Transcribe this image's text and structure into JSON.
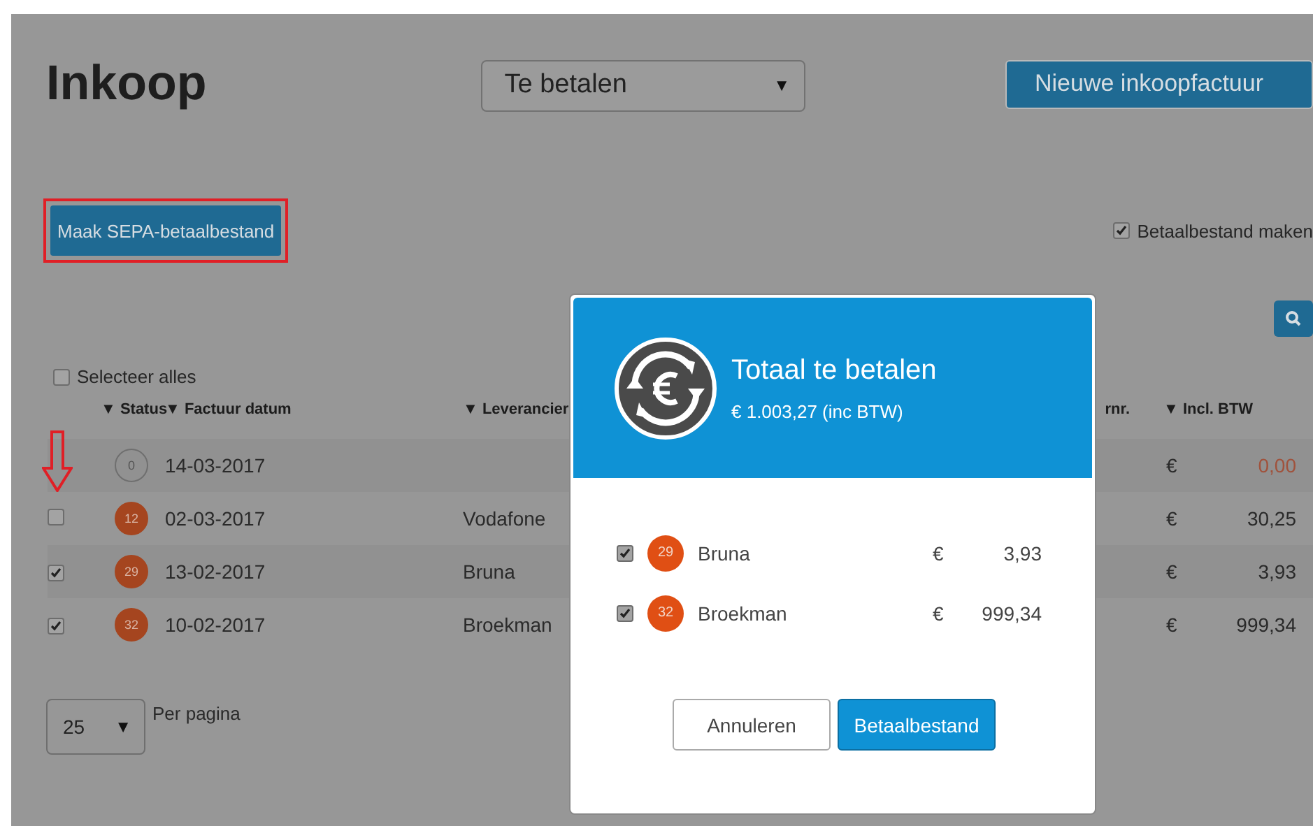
{
  "page": {
    "title": "Inkoop",
    "filter": {
      "value": "Te betalen",
      "arrow": "▼"
    },
    "new_button": "Nieuwe inkoopfactuur"
  },
  "sepa_button": {
    "label": "Maak SEPA-betaalbestand",
    "highlighted": true
  },
  "make_file": {
    "label": "Betaalbestand maken",
    "checked": true
  },
  "select_all": {
    "label": "Selecteer alles",
    "checked": false
  },
  "table": {
    "columns": [
      {
        "label": "▼ Status"
      },
      {
        "label": "▼ Factuur datum"
      },
      {
        "label": "▼ Leverancier"
      },
      {
        "label": "rnr."
      },
      {
        "label": "▼ Incl. BTW"
      }
    ],
    "rows": [
      {
        "kind": "plain",
        "status": "0",
        "outlined": true,
        "date": "14-03-2017",
        "supplier": "",
        "currency": "€",
        "amount": "0,00",
        "zero": true
      },
      {
        "kind": "check",
        "checked": false,
        "status": "12",
        "outlined": false,
        "date": "02-03-2017",
        "supplier": "Vodafone",
        "currency": "€",
        "amount": "30,25",
        "zero": false
      },
      {
        "kind": "check",
        "checked": true,
        "status": "29",
        "outlined": false,
        "date": "13-02-2017",
        "supplier": "Bruna",
        "currency": "€",
        "amount": "3,93",
        "zero": false
      },
      {
        "kind": "check",
        "checked": true,
        "status": "32",
        "outlined": false,
        "date": "10-02-2017",
        "supplier": "Broekman",
        "currency": "€",
        "amount": "999,34",
        "zero": false
      }
    ]
  },
  "pagination": {
    "value": "25",
    "arrow": "▼",
    "label": "Per pagina"
  },
  "dialog": {
    "title": "Totaal te betalen",
    "subtitle": "€  1.003,27 (inc BTW)",
    "items": [
      {
        "checked": true,
        "status": "29",
        "name": "Bruna",
        "currency": "€",
        "amount": "3,93"
      },
      {
        "checked": true,
        "status": "32",
        "name": "Broekman",
        "currency": "€",
        "amount": "999,34"
      }
    ],
    "buttons": [
      {
        "label": "Annuleren",
        "kind": "secondary"
      },
      {
        "label": "Betaalbestand",
        "kind": "primary"
      }
    ]
  }
}
